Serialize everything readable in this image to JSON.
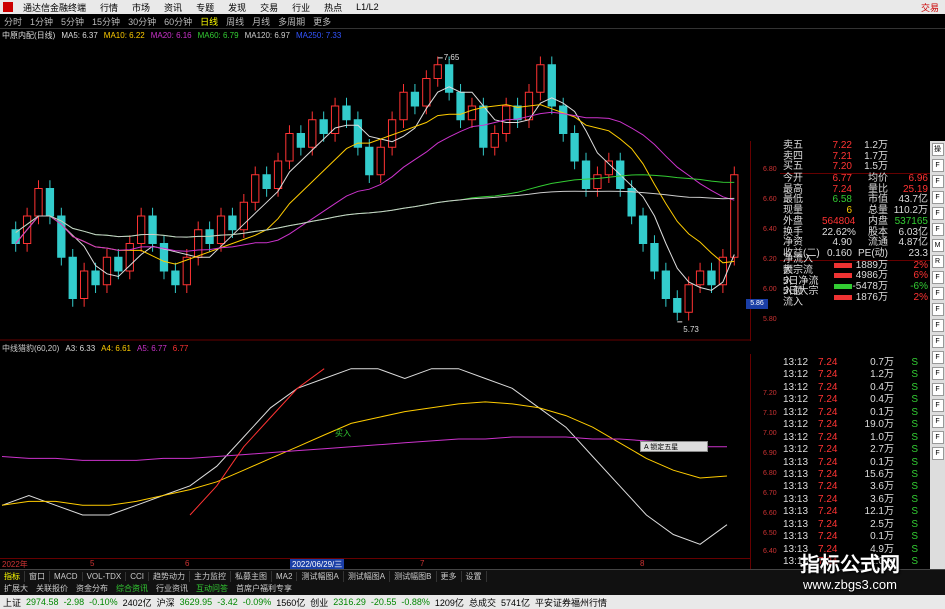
{
  "titlebar": {
    "app": "通达信金融终端",
    "items": [
      "行情",
      "市场",
      "资讯",
      "专题",
      "发现",
      "交易",
      "行业",
      "热点",
      "L1/L2"
    ],
    "trade": "交易"
  },
  "toolbar": {
    "timeframes": [
      "分时",
      "1分钟",
      "5分钟",
      "15分钟",
      "30分钟",
      "60分钟",
      "日线",
      "周线",
      "月线",
      "多周期",
      "更多"
    ],
    "active": "日线"
  },
  "ma_bar": {
    "stock": "中原内配(日线)",
    "items": [
      {
        "label": "MA5: 6.37",
        "color": "#dddddd"
      },
      {
        "label": "MA10: 6.22",
        "color": "#ffcc00"
      },
      {
        "label": "MA20: 6.16",
        "color": "#cc33cc"
      },
      {
        "label": "MA60: 6.79",
        "color": "#33cc33"
      },
      {
        "label": "MA120: 6.97",
        "color": "#cccccc"
      },
      {
        "label": "MA250: 7.33",
        "color": "#3355ff"
      }
    ]
  },
  "ind_bar": {
    "items": [
      {
        "label": "中线猎豹(60,20)",
        "color": "#cccccc"
      },
      {
        "label": "A3: 6.33",
        "color": "#dddddd"
      },
      {
        "label": "A4: 6.61",
        "color": "#ffcc00"
      },
      {
        "label": "A5: 6.77",
        "color": "#cc33cc"
      },
      {
        "label": "6.77",
        "color": "#ff3333"
      }
    ]
  },
  "chart_labels": {
    "high": "7.65",
    "low": "5.73",
    "buy_mark": "买入",
    "current_price_tag": "5.86"
  },
  "price_scale": [
    "6.80",
    "6.60",
    "6.40",
    "6.20",
    "6.00",
    "5.80"
  ],
  "ind_scale": [
    "7.20",
    "7.10",
    "7.00",
    "6.90",
    "6.80",
    "6.70",
    "6.60",
    "6.50",
    "6.40",
    "6.30"
  ],
  "quote_top": [
    {
      "label": "卖五",
      "price": "7.22",
      "vol": "1.2万"
    },
    {
      "label": "卖四",
      "price": "7.21",
      "vol": "1.7万"
    },
    {
      "label": "买五",
      "price": "7.20",
      "vol": "1.5万"
    }
  ],
  "quote_info": [
    {
      "l1": "今开",
      "v1": "6.77",
      "l2": "均价",
      "v2": "6.96",
      "c1": "red",
      "c2": "red"
    },
    {
      "l1": "最高",
      "v1": "7.24",
      "l2": "量比",
      "v2": "25.19",
      "c1": "red",
      "c2": "red"
    },
    {
      "l1": "最低",
      "v1": "6.58",
      "l2": "市值",
      "v2": "43.7亿",
      "c1": "green",
      "c2": "white"
    },
    {
      "l1": "现量",
      "v1": "6",
      "l2": "总量",
      "v2": "110.2万",
      "c1": "yellow",
      "c2": "white"
    },
    {
      "l1": "外盘",
      "v1": "564804",
      "l2": "内盘",
      "v2": "537165",
      "c1": "red",
      "c2": "green"
    },
    {
      "l1": "换手",
      "v1": "22.62%",
      "l2": "股本",
      "v2": "6.03亿",
      "c1": "white",
      "c2": "white"
    },
    {
      "l1": "净资",
      "v1": "4.90",
      "l2": "流通",
      "v2": "4.87亿",
      "c1": "white",
      "c2": "white"
    },
    {
      "l1": "收益(二)",
      "v1": "0.160",
      "l2": "PE(动)",
      "v2": "23.3",
      "c1": "white",
      "c2": "white"
    }
  ],
  "flows": [
    {
      "label": "净流入额",
      "value": "1889万",
      "pct": "2%",
      "color": "red"
    },
    {
      "label": "大宗流入",
      "value": "4986万",
      "pct": "6%",
      "color": "red"
    },
    {
      "label": "5日净流入额",
      "value": "-5478万",
      "pct": "-6%",
      "color": "green"
    },
    {
      "label": "5日大宗流入",
      "value": "1876万",
      "pct": "2%",
      "color": "red"
    }
  ],
  "ticks": [
    {
      "time": "13:12",
      "price": "7.24",
      "vol": "0.7万",
      "bs": "S"
    },
    {
      "time": "13:12",
      "price": "7.24",
      "vol": "1.2万",
      "bs": "S"
    },
    {
      "time": "13:12",
      "price": "7.24",
      "vol": "0.4万",
      "bs": "S"
    },
    {
      "time": "13:12",
      "price": "7.24",
      "vol": "0.4万",
      "bs": "S"
    },
    {
      "time": "13:12",
      "price": "7.24",
      "vol": "0.1万",
      "bs": "S"
    },
    {
      "time": "13:12",
      "price": "7.24",
      "vol": "19.0万",
      "bs": "S"
    },
    {
      "time": "13:12",
      "price": "7.24",
      "vol": "1.0万",
      "bs": "S"
    },
    {
      "time": "13:12",
      "price": "7.24",
      "vol": "2.7万",
      "bs": "S"
    },
    {
      "time": "13:13",
      "price": "7.24",
      "vol": "0.1万",
      "bs": "S"
    },
    {
      "time": "13:13",
      "price": "7.24",
      "vol": "15.6万",
      "bs": "S"
    },
    {
      "time": "13:13",
      "price": "7.24",
      "vol": "3.6万",
      "bs": "S"
    },
    {
      "time": "13:13",
      "price": "7.24",
      "vol": "3.6万",
      "bs": "S"
    },
    {
      "time": "13:13",
      "price": "7.24",
      "vol": "12.1万",
      "bs": "S"
    },
    {
      "time": "13:13",
      "price": "7.24",
      "vol": "2.5万",
      "bs": "S"
    },
    {
      "time": "13:13",
      "price": "7.24",
      "vol": "0.1万",
      "bs": "S"
    },
    {
      "time": "13:13",
      "price": "7.24",
      "vol": "4.9万",
      "bs": "S"
    },
    {
      "time": "13:13",
      "price": "7.24",
      "vol": "1.0万",
      "bs": "S"
    }
  ],
  "sidebar": [
    "操",
    "F",
    "F",
    "F",
    "F",
    "F",
    "M",
    "R",
    "F",
    "F",
    "F",
    "F",
    "F",
    "F",
    "F",
    "F",
    "F",
    "F",
    "F",
    "F"
  ],
  "date_bar": {
    "items": [
      "2022年",
      "5",
      "6",
      "7",
      "8"
    ],
    "current": "2022/06/29/三"
  },
  "popup": "A 锁定五星",
  "tabs": [
    "指标",
    "窗口",
    "MACD",
    "VOL-TDX",
    "CCI",
    "趋势动力",
    "主力监控",
    "私募主图",
    "MA2",
    "测试幅图A",
    "测试幅图A",
    "测试幅图B",
    "更多",
    "设置"
  ],
  "tabs2": [
    {
      "label": "扩展大",
      "hl": false
    },
    {
      "label": "关联报价",
      "hl": false
    },
    {
      "label": "资金分布",
      "hl": false
    },
    {
      "label": "综合资讯",
      "hl": true
    },
    {
      "label": "行业资讯",
      "hl": false
    },
    {
      "label": "互动问答",
      "hl": true
    },
    {
      "label": "首席户福利专享",
      "hl": false
    }
  ],
  "statusbar": [
    {
      "label": "上证",
      "value": "2974.58",
      "chg": "-2.98",
      "pct": "-0.10%",
      "amt": "2402亿"
    },
    {
      "label": "沪深",
      "value": "3629.95",
      "chg": "-3.42",
      "pct": "-0.09%",
      "amt": "1560亿"
    },
    {
      "label": "创业",
      "value": "2316.29",
      "chg": "-20.55",
      "pct": "-0.88%",
      "amt": "1209亿"
    }
  ],
  "status_extra": {
    "total_label": "总成交",
    "total": "5741亿",
    "broker": "平安证券福州行情"
  },
  "watermark": {
    "line1": "指标公式网",
    "line2": "www.zbgs3.com"
  },
  "chart_data": [
    {
      "type": "line",
      "title": "中原内配(日线)",
      "note": "candlestick",
      "ylim": [
        5.7,
        7.7
      ],
      "candles": [
        [
          6.4,
          6.3
        ],
        [
          6.3,
          6.5
        ],
        [
          6.5,
          6.7
        ],
        [
          6.7,
          6.5
        ],
        [
          6.5,
          6.2
        ],
        [
          6.2,
          5.9
        ],
        [
          5.9,
          6.1
        ],
        [
          6.1,
          6.0
        ],
        [
          6.0,
          6.2
        ],
        [
          6.2,
          6.1
        ],
        [
          6.1,
          6.3
        ],
        [
          6.3,
          6.5
        ],
        [
          6.5,
          6.3
        ],
        [
          6.3,
          6.1
        ],
        [
          6.1,
          6.0
        ],
        [
          6.0,
          6.2
        ],
        [
          6.2,
          6.4
        ],
        [
          6.4,
          6.3
        ],
        [
          6.3,
          6.5
        ],
        [
          6.5,
          6.4
        ],
        [
          6.4,
          6.6
        ],
        [
          6.6,
          6.8
        ],
        [
          6.8,
          6.7
        ],
        [
          6.7,
          6.9
        ],
        [
          6.9,
          7.1
        ],
        [
          7.1,
          7.0
        ],
        [
          7.0,
          7.2
        ],
        [
          7.2,
          7.1
        ],
        [
          7.1,
          7.3
        ],
        [
          7.3,
          7.2
        ],
        [
          7.2,
          7.0
        ],
        [
          7.0,
          6.8
        ],
        [
          6.8,
          7.0
        ],
        [
          7.0,
          7.2
        ],
        [
          7.2,
          7.4
        ],
        [
          7.4,
          7.3
        ],
        [
          7.3,
          7.5
        ],
        [
          7.5,
          7.6
        ],
        [
          7.6,
          7.4
        ],
        [
          7.4,
          7.2
        ],
        [
          7.2,
          7.3
        ],
        [
          7.3,
          7.0
        ],
        [
          7.0,
          7.1
        ],
        [
          7.1,
          7.3
        ],
        [
          7.3,
          7.2
        ],
        [
          7.2,
          7.4
        ],
        [
          7.4,
          7.6
        ],
        [
          7.6,
          7.3
        ],
        [
          7.3,
          7.1
        ],
        [
          7.1,
          6.9
        ],
        [
          6.9,
          6.7
        ],
        [
          6.7,
          6.8
        ],
        [
          6.8,
          6.9
        ],
        [
          6.9,
          6.7
        ],
        [
          6.7,
          6.5
        ],
        [
          6.5,
          6.3
        ],
        [
          6.3,
          6.1
        ],
        [
          6.1,
          5.9
        ],
        [
          5.9,
          5.8
        ],
        [
          5.8,
          6.0
        ],
        [
          6.0,
          6.1
        ],
        [
          6.1,
          6.0
        ],
        [
          6.0,
          6.2
        ],
        [
          6.2,
          6.8
        ]
      ],
      "series": [
        {
          "name": "MA5",
          "color": "#dddddd"
        },
        {
          "name": "MA10",
          "color": "#ffcc00"
        },
        {
          "name": "MA20",
          "color": "#cc33cc"
        },
        {
          "name": "MA60",
          "color": "#33cc33"
        },
        {
          "name": "MA120",
          "color": "#cccccc"
        }
      ]
    },
    {
      "type": "line",
      "title": "中线猎豹(60,20)",
      "ylim": [
        6.25,
        7.25
      ],
      "series": [
        {
          "name": "A3",
          "color": "#dddddd",
          "values": [
            6.5,
            6.55,
            6.5,
            6.45,
            6.45,
            6.5,
            6.55,
            6.6,
            6.7,
            6.85,
            7.0,
            7.1,
            7.15,
            7.2,
            7.2,
            7.15,
            7.2,
            7.2,
            7.15,
            7.1,
            7.0,
            6.9,
            6.75,
            6.6,
            6.45,
            6.35,
            6.3,
            6.4
          ]
        },
        {
          "name": "A4",
          "color": "#ffcc00",
          "values": [
            6.5,
            6.52,
            6.52,
            6.5,
            6.5,
            6.52,
            6.55,
            6.58,
            6.62,
            6.68,
            6.74,
            6.8,
            6.86,
            6.92,
            6.95,
            6.98,
            7.0,
            7.02,
            7.03,
            7.02,
            7.0,
            6.96,
            6.9,
            6.82,
            6.74,
            6.68,
            6.64,
            6.65
          ]
        },
        {
          "name": "A5",
          "color": "#cc33cc",
          "values": [
            6.75,
            6.74,
            6.74,
            6.73,
            6.73,
            6.73,
            6.74,
            6.74,
            6.75,
            6.76,
            6.77,
            6.78,
            6.79,
            6.8,
            6.81,
            6.82,
            6.83,
            6.84,
            6.84,
            6.85,
            6.85,
            6.85,
            6.84,
            6.84,
            6.83,
            6.82,
            6.8,
            6.8
          ]
        },
        {
          "name": "6.77",
          "color": "#ff3333",
          "values": [
            null,
            null,
            null,
            null,
            null,
            null,
            null,
            6.45,
            6.6,
            6.8,
            6.95,
            7.1,
            7.2,
            null,
            null,
            null,
            null,
            null,
            null,
            null,
            null,
            null,
            null,
            null,
            null,
            null,
            null,
            6.45
          ]
        }
      ]
    }
  ]
}
